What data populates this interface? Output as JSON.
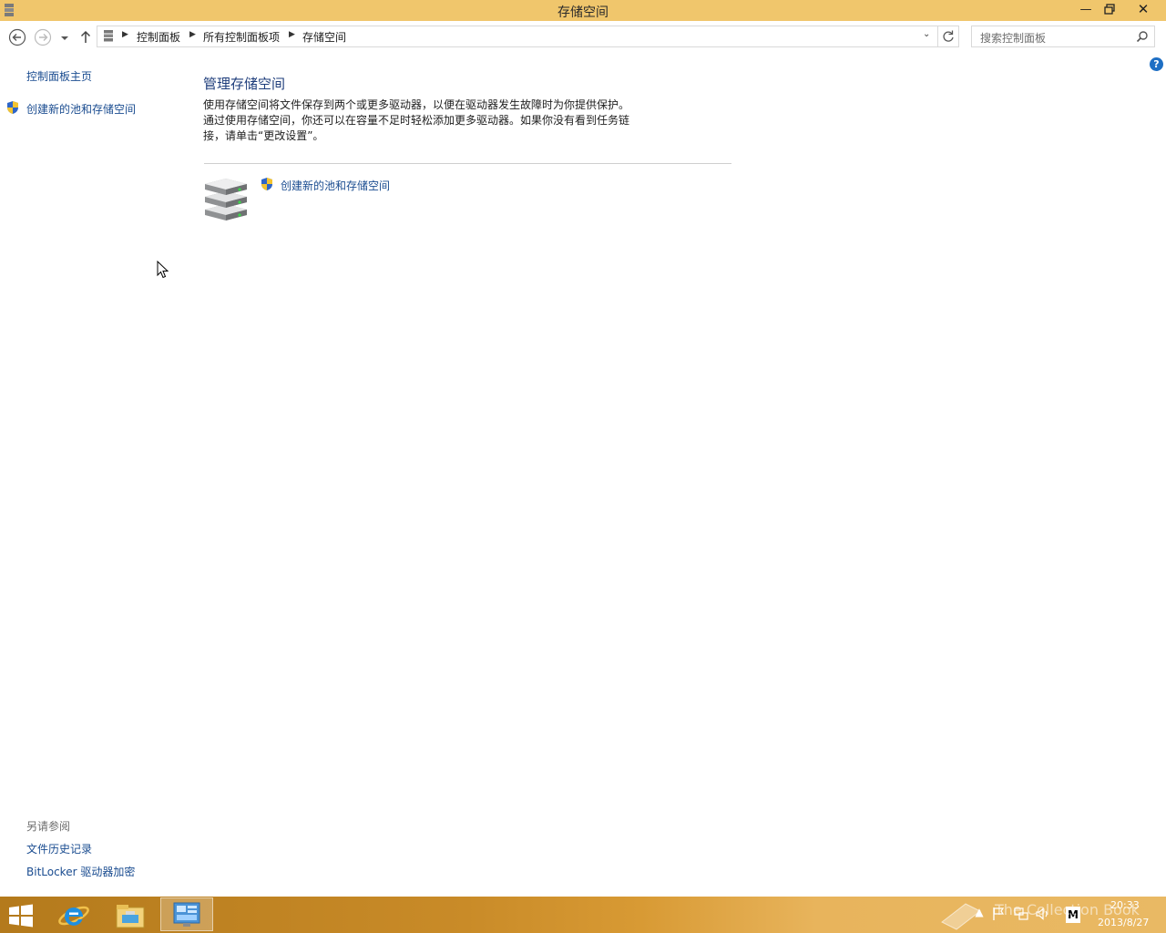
{
  "window": {
    "title": "存储空间"
  },
  "nav": {
    "breadcrumbs": [
      "控制面板",
      "所有控制面板项",
      "存储空间"
    ],
    "search_placeholder": "搜索控制面板"
  },
  "left_pane": {
    "home": "控制面板主页",
    "create": "创建新的池和存储空间",
    "see_also_header": "另请参阅",
    "see_also": [
      "文件历史记录",
      "BitLocker 驱动器加密"
    ]
  },
  "main": {
    "heading": "管理存储空间",
    "description": [
      "使用存储空间将文件保存到两个或更多驱动器，以便在驱动器发生故障时为你提供保护。",
      "通过使用存储空间，你还可以在容量不足时轻松添加更多驱动器。如果你没有看到任务链",
      "接，请单击“更改设置”。"
    ],
    "create_link": "创建新的池和存储空间"
  },
  "taskbar": {
    "time": "20:33",
    "date": "2013/8/27",
    "watermark": "The Collection Book",
    "ime_label": "M"
  },
  "colors": {
    "titlebar": "#f0c66c",
    "link": "#1a4c90",
    "heading": "#1e3d7b"
  }
}
